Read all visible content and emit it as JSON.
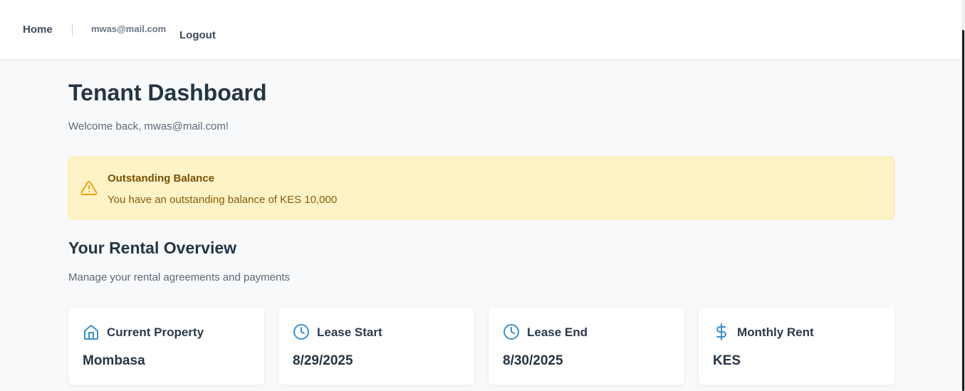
{
  "nav": {
    "home_label": "Home",
    "user_email": "mwas@mail.com",
    "logout_label": "Logout"
  },
  "header": {
    "title": "Tenant Dashboard",
    "welcome": "Welcome back, mwas@mail.com!"
  },
  "alert": {
    "title": "Outstanding Balance",
    "message": "You have an outstanding balance of KES 10,000",
    "icon": "warning-triangle-icon",
    "color": "#f59e0b"
  },
  "overview": {
    "title": "Your Rental Overview",
    "subtitle": "Manage your rental agreements and payments"
  },
  "cards": [
    {
      "label": "Current Property",
      "value": "Mombasa",
      "icon": "home-icon"
    },
    {
      "label": "Lease Start",
      "value": "8/29/2025",
      "icon": "clock-icon"
    },
    {
      "label": "Lease End",
      "value": "8/30/2025",
      "icon": "clock-icon"
    },
    {
      "label": "Monthly Rent",
      "value": "KES",
      "icon": "dollar-icon"
    }
  ],
  "colors": {
    "accent": "#3b8fcf",
    "alert_bg": "#fef3c7",
    "alert_text": "#8a5a0a"
  }
}
